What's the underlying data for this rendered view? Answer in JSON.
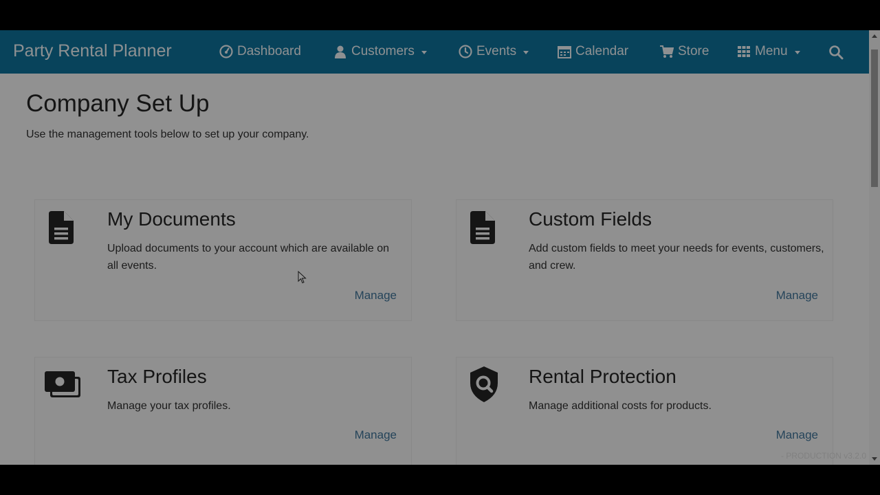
{
  "navbar": {
    "brand": "Party Rental Planner",
    "items": [
      {
        "label": "Dashboard",
        "icon": "dashboard-icon"
      },
      {
        "label": "Customers",
        "icon": "user-icon",
        "dropdown": true
      },
      {
        "label": "Events",
        "icon": "clock-icon",
        "dropdown": true
      },
      {
        "label": "Calendar",
        "icon": "calendar-icon"
      },
      {
        "label": "Store",
        "icon": "cart-icon"
      },
      {
        "label": "Menu",
        "icon": "grid-icon",
        "dropdown": true
      }
    ],
    "search_icon": "search-icon",
    "bg_color": "#0e6d93"
  },
  "page": {
    "title": "Company Set Up",
    "description": "Use the management tools below to set up your company."
  },
  "cards": [
    {
      "title": "My Documents",
      "description": "Upload documents to your account which are available on all events.",
      "link": "Manage",
      "icon": "document-icon"
    },
    {
      "title": "Custom Fields",
      "description": "Add custom fields to meet your needs for events, customers, and crew.",
      "link": "Manage",
      "icon": "document-icon"
    },
    {
      "title": "Tax Profiles",
      "description": "Manage your tax profiles.",
      "link": "Manage",
      "icon": "money-icon"
    },
    {
      "title": "Rental Protection",
      "description": "Manage additional costs for products.",
      "link": "Manage",
      "icon": "shield-search-icon"
    }
  ],
  "footer": {
    "version": "- PRODUCTION v3.2.0"
  }
}
